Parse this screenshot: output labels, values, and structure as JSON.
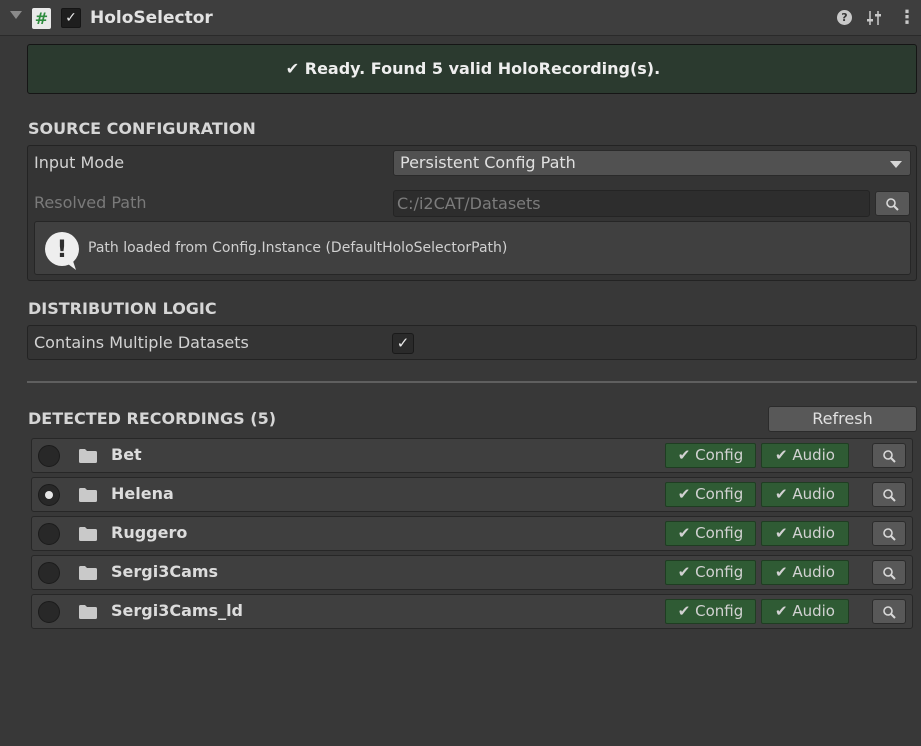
{
  "header": {
    "script_glyph": "#",
    "enabled_check": "✓",
    "title": "HoloSelector",
    "help_glyph": "?",
    "menu_glyph": "⋮"
  },
  "status": {
    "text": "✔ Ready. Found 5 valid HoloRecording(s)."
  },
  "source_configuration": {
    "title": "SOURCE CONFIGURATION",
    "input_mode": {
      "label": "Input Mode",
      "value": "Persistent Config Path"
    },
    "resolved_path": {
      "label": "Resolved Path",
      "value": "C:/i2CAT/Datasets"
    },
    "helpbox": {
      "icon_glyph": "!",
      "text": "Path loaded from Config.Instance (DefaultHoloSelectorPath)"
    }
  },
  "distribution_logic": {
    "title": "DISTRIBUTION LOGIC",
    "multiple_datasets": {
      "label": "Contains Multiple Datasets",
      "checked": true,
      "check_glyph": "✓"
    }
  },
  "detected_recordings": {
    "title": "DETECTED RECORDINGS (5)",
    "refresh_label": "Refresh",
    "config_badge": "✔ Config",
    "audio_badge": "✔ Audio",
    "items": [
      {
        "name": "Bet",
        "selected": false
      },
      {
        "name": "Helena",
        "selected": true
      },
      {
        "name": "Ruggero",
        "selected": false
      },
      {
        "name": "Sergi3Cams",
        "selected": false
      },
      {
        "name": "Sergi3Cams_ld",
        "selected": false
      }
    ]
  },
  "icons": {
    "script": "hash-script-icon",
    "presets": "sliders-presets-icon",
    "help": "question-circle-icon",
    "menu": "kebab-menu-icon",
    "folder": "folder-icon",
    "search": "magnifier-icon",
    "warning": "exclamation-speech-bubble-icon"
  },
  "colors": {
    "background": "#383838",
    "status_banner": "#2b3a2f",
    "badge_green": "#2f5b34"
  }
}
